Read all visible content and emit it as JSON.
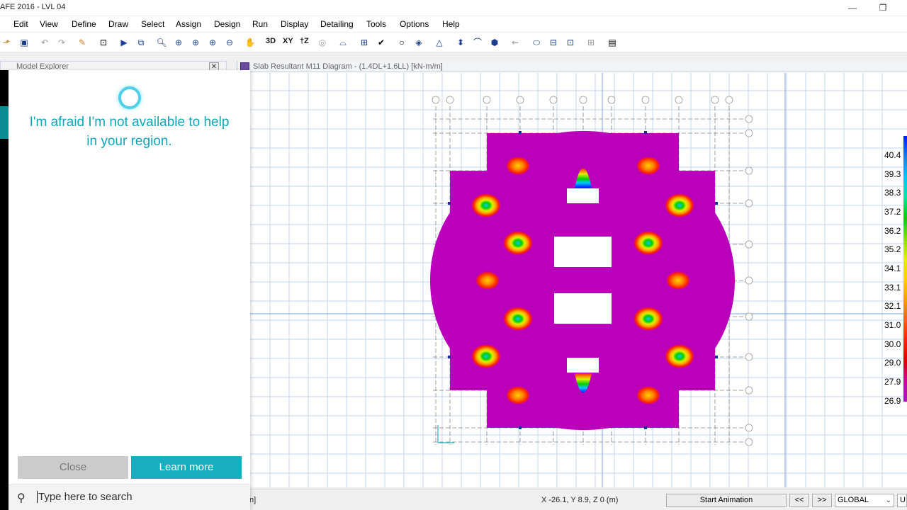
{
  "window": {
    "title": "AFE 2016 - LVL 04",
    "minimize": "—",
    "maximize": "❐"
  },
  "menu": [
    "Edit",
    "View",
    "Define",
    "Draw",
    "Select",
    "Assign",
    "Design",
    "Run",
    "Display",
    "Detailing",
    "Tools",
    "Options",
    "Help"
  ],
  "toolbar": {
    "view_3d": "3D",
    "view_xy": "XY",
    "view_z": "†Z"
  },
  "explorer": {
    "title": "Model Explorer",
    "close": "✕"
  },
  "drawing": {
    "title": "Slab Resultant M11 Diagram - (1.4DL+1.6LL)  [kN-m/m]"
  },
  "legend": {
    "values": [
      "40.4",
      "39.3",
      "38.3",
      "37.2",
      "36.2",
      "35.2",
      "34.1",
      "33.1",
      "32.1",
      "31.0",
      "30.0",
      "29.0",
      "27.9",
      "26.9"
    ],
    "colors": [
      "#0019ff",
      "#0080ff",
      "#00c8ff",
      "#00e8a0",
      "#00d000",
      "#80e000",
      "#e0f000",
      "#ffd000",
      "#ffa000",
      "#ff6000",
      "#ff2000",
      "#e00000",
      "#d000a0",
      "#c000c0"
    ]
  },
  "cortana": {
    "message": "I'm afraid I'm not available to help in your region.",
    "close_label": "Close",
    "learn_more_label": "Learn more",
    "search_placeholder": "Type here to search"
  },
  "status": {
    "left_fragment": "n]",
    "coords": "X -26.1,  Y 8.9,  Z 0  (m)",
    "start_animation": "Start Animation",
    "prev": "<<",
    "next": ">>",
    "coord_system": "GLOBAL",
    "units_fragment": "U"
  }
}
